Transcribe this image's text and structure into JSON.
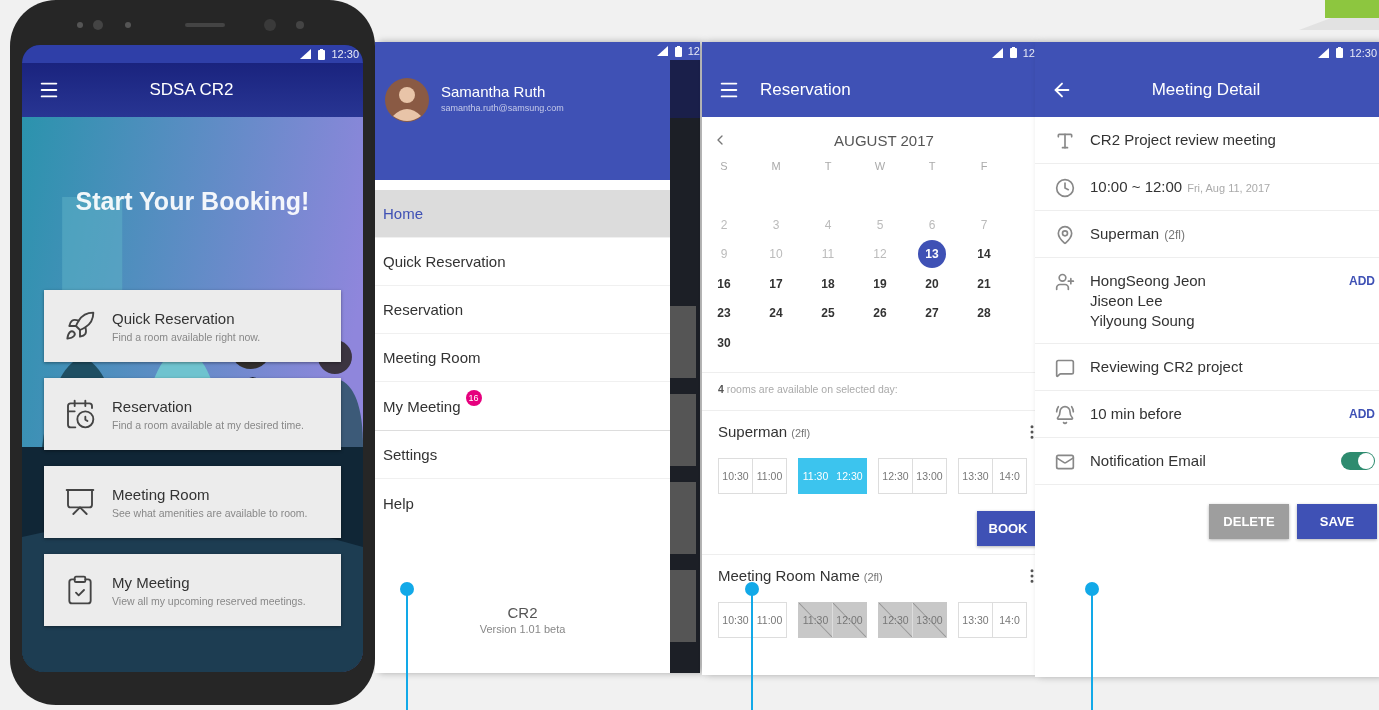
{
  "phone": {
    "status_time": "12:30",
    "title": "SDSA CR2",
    "hero_text": "Start Your Booking!",
    "cards": [
      {
        "title": "Quick Reservation",
        "subtitle": "Find a room available right now."
      },
      {
        "title": "Reservation",
        "subtitle": "Find a room available at my desired time."
      },
      {
        "title": "Meeting Room",
        "subtitle": "See what amenities are available to room."
      },
      {
        "title": "My Meeting",
        "subtitle": "View all my upcoming reserved meetings."
      }
    ]
  },
  "drawer": {
    "status_time": "12",
    "user": {
      "name": "Samantha Ruth",
      "email": "samantha.ruth@samsung.com"
    },
    "items": [
      {
        "label": "Home",
        "selected": true
      },
      {
        "label": "Quick Reservation",
        "selected": false
      },
      {
        "label": "Reservation",
        "selected": false
      },
      {
        "label": "Meeting Room",
        "selected": false
      },
      {
        "label": "My Meeting",
        "selected": false,
        "badge": "16"
      }
    ],
    "secondary_items": [
      {
        "label": "Settings",
        "selected": false
      },
      {
        "label": "Help",
        "selected": false
      }
    ],
    "footer": {
      "app": "CR2",
      "version": "Version 1.01 beta"
    }
  },
  "reservation": {
    "status_time": "12",
    "title": "Reservation",
    "calendar": {
      "month": "AUGUST 2017",
      "weekdays": [
        "S",
        "M",
        "T",
        "W",
        "T",
        "F"
      ],
      "weeks": [
        [
          {
            "day": "2",
            "disabled": true,
            "selected": false
          },
          {
            "day": "3",
            "disabled": true,
            "selected": false
          },
          {
            "day": "4",
            "disabled": true,
            "selected": false
          },
          {
            "day": "5",
            "disabled": true,
            "selected": false
          },
          {
            "day": "6",
            "disabled": true,
            "selected": false
          },
          {
            "day": "7",
            "disabled": true,
            "selected": false
          }
        ],
        [
          {
            "day": "9",
            "disabled": true,
            "selected": false
          },
          {
            "day": "10",
            "disabled": true,
            "selected": false
          },
          {
            "day": "11",
            "disabled": true,
            "selected": false
          },
          {
            "day": "12",
            "disabled": true,
            "selected": false
          },
          {
            "day": "13",
            "disabled": false,
            "selected": true
          },
          {
            "day": "14",
            "disabled": false,
            "selected": false
          }
        ],
        [
          {
            "day": "16",
            "disabled": false,
            "selected": false
          },
          {
            "day": "17",
            "disabled": false,
            "selected": false
          },
          {
            "day": "18",
            "disabled": false,
            "selected": false
          },
          {
            "day": "19",
            "disabled": false,
            "selected": false
          },
          {
            "day": "20",
            "disabled": false,
            "selected": false
          },
          {
            "day": "21",
            "disabled": false,
            "selected": false
          }
        ],
        [
          {
            "day": "23",
            "disabled": false,
            "selected": false
          },
          {
            "day": "24",
            "disabled": false,
            "selected": false
          },
          {
            "day": "25",
            "disabled": false,
            "selected": false
          },
          {
            "day": "26",
            "disabled": false,
            "selected": false
          },
          {
            "day": "27",
            "disabled": false,
            "selected": false
          },
          {
            "day": "28",
            "disabled": false,
            "selected": false
          }
        ],
        [
          {
            "day": "30",
            "disabled": false,
            "selected": false
          }
        ]
      ]
    },
    "availability": {
      "count": "4",
      "text": "rooms are available on selected day:"
    },
    "rooms": [
      {
        "name": "Superman",
        "floor": "(2fl)",
        "book_button": "BOOK",
        "slots": [
          {
            "times": [
              "10:30",
              "11:00"
            ],
            "selected": false,
            "disabled": false
          },
          {
            "times": [
              "11:30",
              "12:30"
            ],
            "selected": true,
            "disabled": false
          },
          {
            "times": [
              "12:30",
              "13:00"
            ],
            "selected": false,
            "disabled": false
          },
          {
            "times": [
              "13:30",
              "14:0"
            ],
            "selected": false,
            "disabled": false
          }
        ]
      },
      {
        "name": "Meeting Room Name",
        "floor": "(2fl)",
        "slots": [
          {
            "times": [
              "10:30",
              "11:00"
            ],
            "selected": false,
            "disabled": false
          },
          {
            "times": [
              "11:30",
              "12:00"
            ],
            "selected": false,
            "disabled": true
          },
          {
            "times": [
              "12:30",
              "13:00"
            ],
            "selected": false,
            "disabled": true
          },
          {
            "times": [
              "13:30",
              "14:0"
            ],
            "selected": false,
            "disabled": false
          }
        ]
      }
    ]
  },
  "detail": {
    "status_time": "12:30",
    "title": "Meeting Detail",
    "rows": [
      {
        "kind": "title",
        "text": "CR2 Project review meeting"
      },
      {
        "kind": "time",
        "text": "10:00 ~ 12:00",
        "note": "Fri, Aug 11, 2017"
      },
      {
        "kind": "location",
        "text": "Superman",
        "note": "(2fl)"
      },
      {
        "kind": "attendees",
        "lines": [
          "HongSeong Jeon",
          "Jiseon Lee",
          "Yilyoung Soung"
        ],
        "action": "ADD"
      },
      {
        "kind": "description",
        "text": "Reviewing CR2 project"
      },
      {
        "kind": "reminder",
        "text": "10 min before",
        "action": "ADD"
      },
      {
        "kind": "email",
        "text": "Notification Email",
        "on": true
      }
    ],
    "buttons": [
      {
        "label": "DELETE",
        "kind": "secondary"
      },
      {
        "label": "SAVE",
        "kind": "primary"
      }
    ]
  }
}
